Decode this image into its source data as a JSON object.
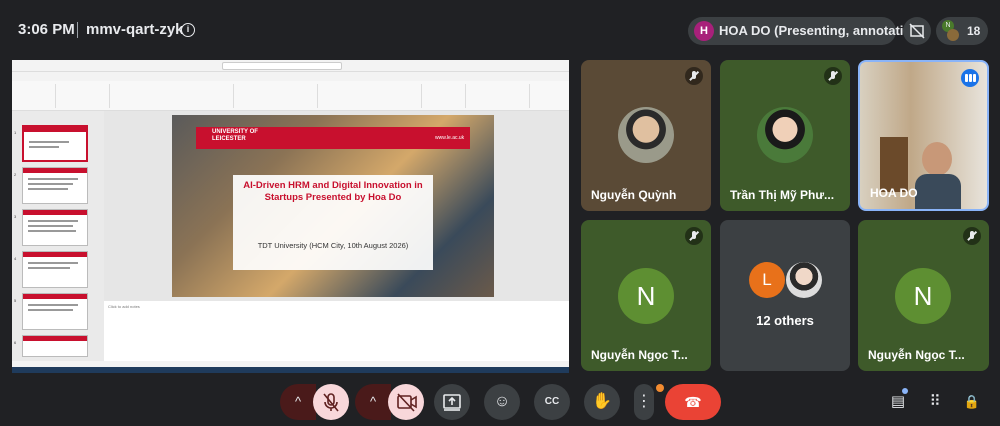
{
  "header": {
    "time": "3:06 PM",
    "meeting_code": "mmv-qart-zyk",
    "info_icon": "i"
  },
  "presenter": {
    "avatar_letter": "H",
    "label": "HOA DO (Presenting, annotating)"
  },
  "participants_count": "18",
  "participants_avatar_letter": "N",
  "slide": {
    "university": "UNIVERSITY OF\nLEICESTER",
    "website": "www.le.ac.uk",
    "title": "AI-Driven HRM and Digital Innovation in Startups Presented by Hoa Do",
    "subtitle": "TDT University (HCM City, 10th August 2026)"
  },
  "ppt": {
    "ribbon_tabs": [
      "File",
      "Home",
      "Insert",
      "Draw",
      "Design",
      "Transitions",
      "Animations",
      "Slide Show",
      "Record",
      "Review",
      "View",
      "Help",
      "Acrobat",
      "Tell me"
    ],
    "notes_placeholder": "Click to add notes",
    "thumb_numbers": [
      "1",
      "2",
      "3",
      "4",
      "5",
      "6"
    ]
  },
  "tiles": {
    "t1": {
      "name": "Nguyễn Quỳnh"
    },
    "t2": {
      "name": "Trần Thị Mỹ Phư..."
    },
    "t3": {
      "name": "HOA DO"
    },
    "t4": {
      "name": "Nguyễn Ngọc T...",
      "letter": "N"
    },
    "t5": {
      "name": "12 others",
      "letter": "L"
    },
    "t6": {
      "name": "Nguyễn Ngọc T...",
      "letter": "N"
    }
  },
  "controls": {
    "arrow": "^",
    "emoji": "☺",
    "captions": "CC",
    "hand": "✋",
    "more": "⋮",
    "end_call": "☎",
    "chat": "▤",
    "activities": "⠿",
    "lock": "🔒"
  },
  "colors": {
    "bg": "#202124",
    "end": "#ea4335",
    "accent": "#1a73e8",
    "avatar_green": "#5e8f32"
  }
}
